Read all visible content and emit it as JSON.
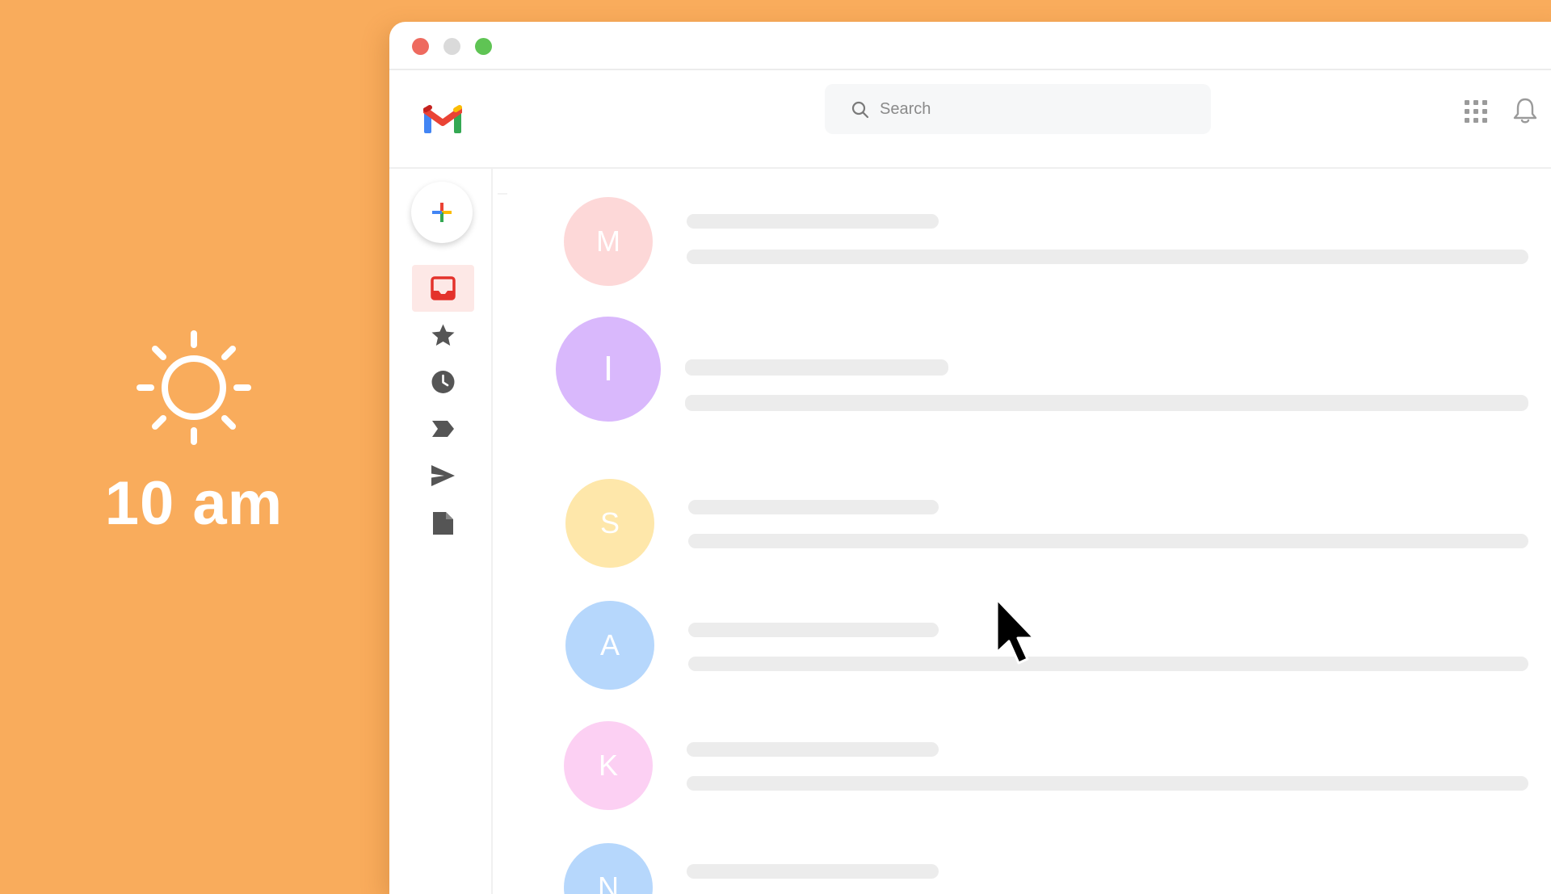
{
  "time": {
    "label": "10 am"
  },
  "window": {
    "traffic_lights": [
      "#EE6A5F",
      "#DADADA",
      "#5FC454"
    ]
  },
  "header": {
    "search": {
      "placeholder": "Search"
    }
  },
  "sidebar": {
    "items": [
      {
        "name": "inbox-icon",
        "active": true
      },
      {
        "name": "star-icon",
        "active": false
      },
      {
        "name": "clock-icon",
        "active": false
      },
      {
        "name": "label-icon",
        "active": false
      },
      {
        "name": "send-icon",
        "active": false
      },
      {
        "name": "document-icon",
        "active": false
      }
    ]
  },
  "emails": [
    {
      "initial": "M",
      "color": "#FDD8D8"
    },
    {
      "initial": "I",
      "color": "#D9B8FC"
    },
    {
      "initial": "S",
      "color": "#FEE7AA"
    },
    {
      "initial": "A",
      "color": "#B6D7FC"
    },
    {
      "initial": "K",
      "color": "#FCD0F3"
    },
    {
      "initial": "N",
      "color": "#B6D7FC"
    }
  ],
  "colors": {
    "background": "#F9AC5C",
    "accent_red": "#E4322B",
    "skeleton": "#ECECEC"
  }
}
